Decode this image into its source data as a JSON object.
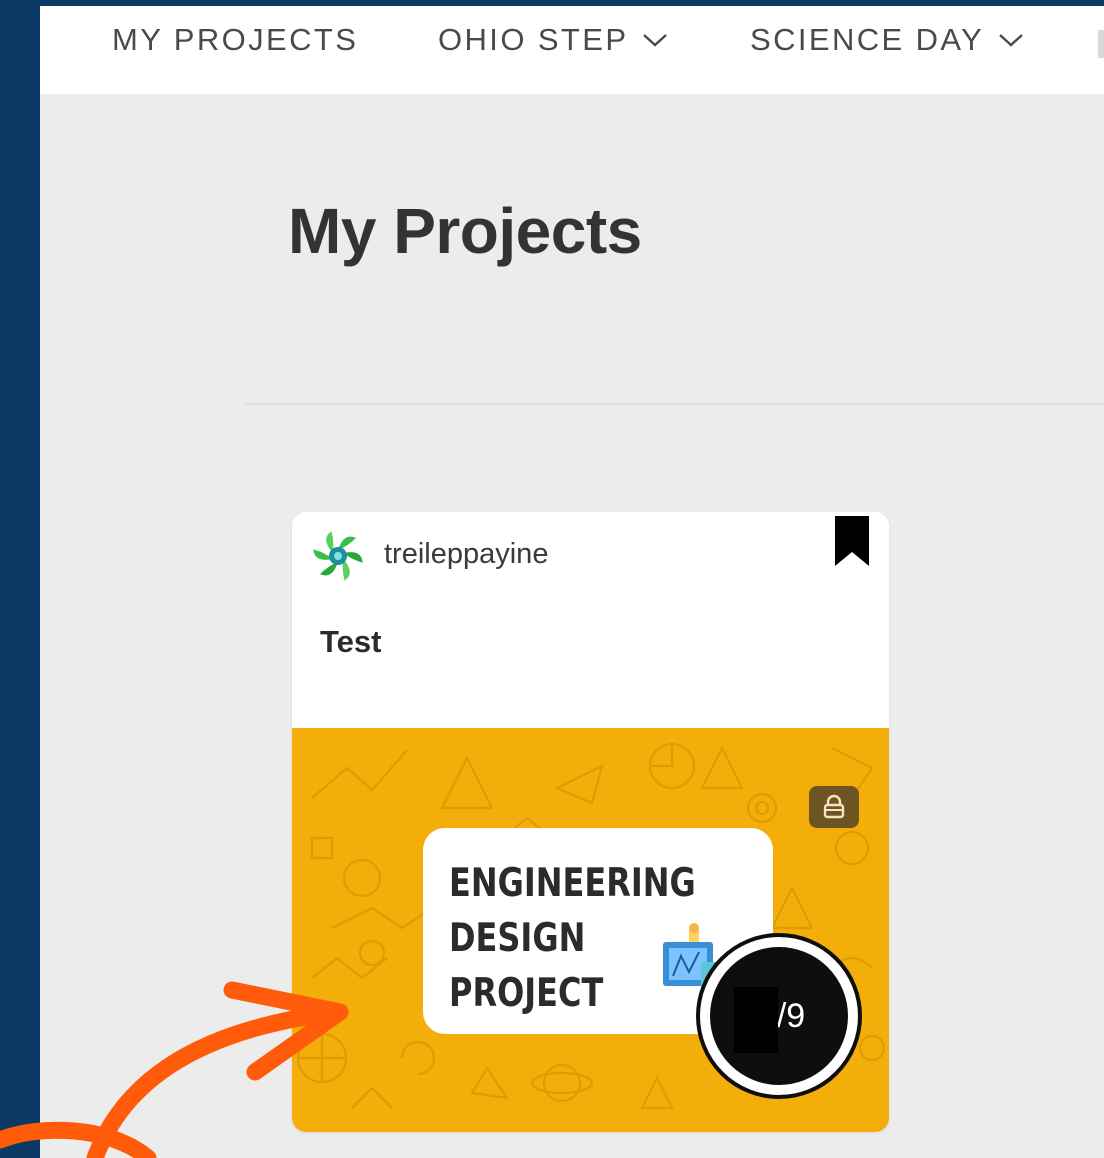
{
  "nav": {
    "items": [
      {
        "label": "MY PROJECTS",
        "has_dropdown": false
      },
      {
        "label": "OHIO STEP",
        "has_dropdown": true
      },
      {
        "label": "SCIENCE DAY",
        "has_dropdown": true
      }
    ]
  },
  "page": {
    "title": "My Projects"
  },
  "project_card": {
    "username": "treileppayine",
    "title": "Test",
    "bookmarked": true,
    "locked": true,
    "cover": {
      "line1": "ENGINEERING",
      "line2": "DESIGN",
      "line3": "PROJECT",
      "background_color": "#f3ae0a"
    },
    "progress_label": "/9"
  },
  "annotation": {
    "arrow_color": "#ff5b0a"
  },
  "colors": {
    "page_border": "#0b3a64",
    "content_bg": "#ececec"
  },
  "icons": {
    "avatar": "green-pinwheel-icon",
    "bookmark": "bookmark-filled-icon",
    "lock": "lock-icon",
    "dropdown": "chevron-down-icon"
  }
}
